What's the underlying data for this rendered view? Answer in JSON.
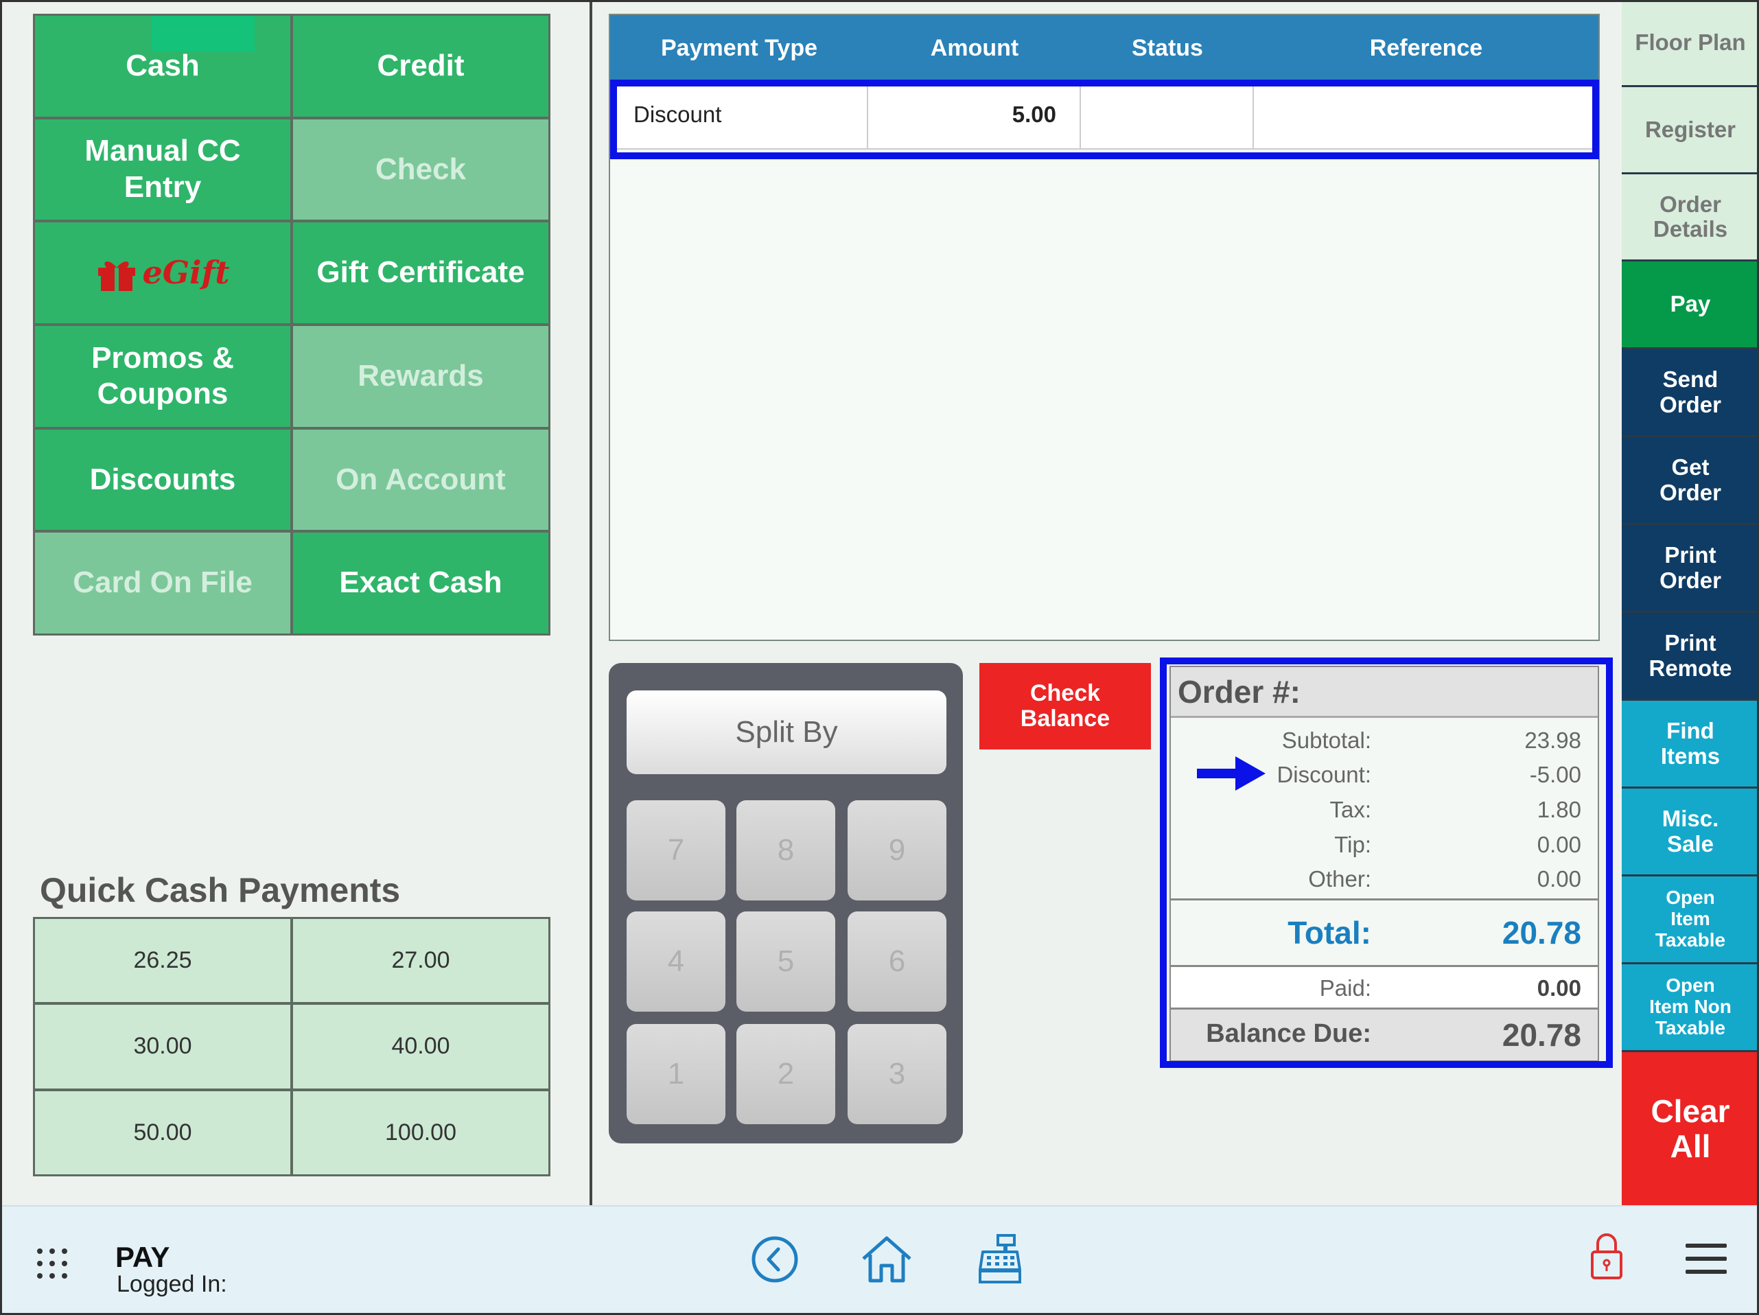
{
  "payment_methods": {
    "cash": "Cash",
    "credit": "Credit",
    "manual_cc": "Manual CC\nEntry",
    "check": "Check",
    "egift": "eGift",
    "gift_certificate": "Gift Certificate",
    "promos": "Promos &\nCoupons",
    "rewards": "Rewards",
    "discounts": "Discounts",
    "on_account": "On Account",
    "card_on_file": "Card On File",
    "exact_cash": "Exact Cash"
  },
  "quick_cash": {
    "title": "Quick Cash Payments",
    "amounts": [
      "26.25",
      "27.00",
      "30.00",
      "40.00",
      "50.00",
      "100.00"
    ]
  },
  "payments_table": {
    "headers": [
      "Payment Type",
      "Amount",
      "Status",
      "Reference"
    ],
    "rows": [
      {
        "type": "Discount",
        "amount": "5.00",
        "status": "",
        "reference": ""
      }
    ]
  },
  "keypad": {
    "split_label": "Split By",
    "keys": [
      "7",
      "8",
      "9",
      "4",
      "5",
      "6",
      "1",
      "2",
      "3"
    ]
  },
  "check_balance_label": "Check\nBalance",
  "order_summary": {
    "title": "Order #:",
    "subtotal_label": "Subtotal:",
    "subtotal": "23.98",
    "discount_label": "Discount:",
    "discount": "-5.00",
    "tax_label": "Tax:",
    "tax": "1.80",
    "tip_label": "Tip:",
    "tip": "0.00",
    "other_label": "Other:",
    "other": "0.00",
    "total_label": "Total:",
    "total": "20.78",
    "paid_label": "Paid:",
    "paid": "0.00",
    "balance_label": "Balance Due:",
    "balance": "20.78"
  },
  "right_nav": {
    "floor_plan": "Floor Plan",
    "register": "Register",
    "order_details": "Order\nDetails",
    "pay": "Pay",
    "send_order": "Send\nOrder",
    "get_order": "Get\nOrder",
    "print_order": "Print\nOrder",
    "print_remote": "Print\nRemote",
    "find_items": "Find\nItems",
    "misc_sale": "Misc.\nSale",
    "open_item_taxable": "Open\nItem\nTaxable",
    "open_item_non_taxable": "Open\nItem Non\nTaxable",
    "clear_all": "Clear\nAll"
  },
  "bottom_bar": {
    "screen_title": "PAY",
    "logged_in": "Logged In:"
  },
  "colors": {
    "green": "#2eb56a",
    "green_disabled": "#7bc79a",
    "table_header": "#2a82b8",
    "highlight": "#0a12e8",
    "navy": "#0f3c64",
    "teal": "#14a9cb",
    "red": "#ec2424"
  },
  "icons": [
    "apps-grid-icon",
    "back-circle-icon",
    "home-icon",
    "cash-register-icon",
    "lock-icon",
    "hamburger-menu-icon",
    "gift-icon",
    "arrow-right-icon"
  ]
}
